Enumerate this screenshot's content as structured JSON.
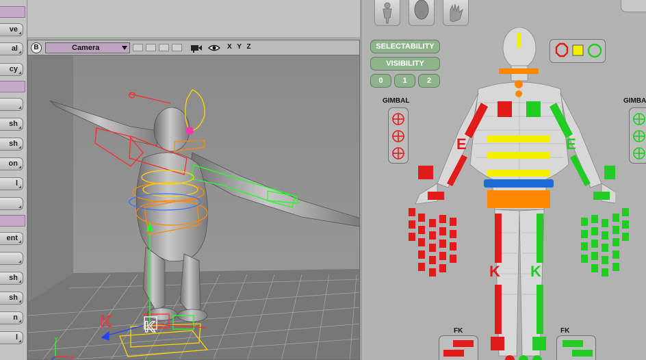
{
  "left_shelf": {
    "buttons": [
      {
        "label": "ve"
      },
      {
        "label": "al"
      },
      {
        "label": "cy"
      },
      {
        "label": ""
      },
      {
        "label": "sh"
      },
      {
        "label": "sh"
      },
      {
        "label": "on"
      },
      {
        "label": "l"
      },
      {
        "label": ""
      },
      {
        "label": "ent"
      },
      {
        "label": ""
      },
      {
        "label": "sh"
      },
      {
        "label": "sh"
      },
      {
        "label": "n"
      },
      {
        "label": "l"
      }
    ]
  },
  "viewport": {
    "badge": "B",
    "camera": "Camera",
    "axes": "X Y Z",
    "scene_labels": {
      "k_left": "K",
      "k_right": "K"
    },
    "gizmo": {
      "y": "Y",
      "x": "X"
    }
  },
  "picker": {
    "selectability_label": "SELECTABILITY",
    "visibility_label": "VISIBILITY",
    "level_buttons": [
      "0",
      "1",
      "2"
    ],
    "gimbal_left": "GIMBAL",
    "gimbal_right": "GIMBA",
    "fk_left": "FK",
    "fk_right": "FK",
    "letters": {
      "e_left": "E",
      "e_right": "E",
      "k_left": "K",
      "k_right": "K"
    },
    "colors": {
      "left_side": "#e11a1a",
      "right_side": "#22cc22",
      "spine": "#f5f000",
      "hips": "#ff8800",
      "waist": "#1e6bd6"
    }
  }
}
